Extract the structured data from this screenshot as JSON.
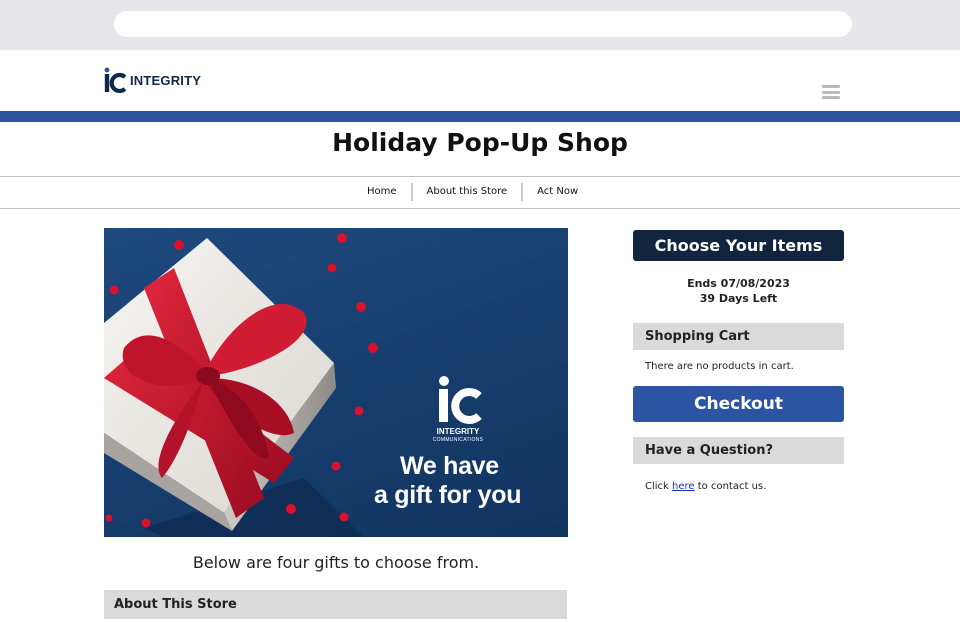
{
  "browser": {
    "url_value": ""
  },
  "header": {
    "logo_text": "INTEGRITY",
    "menu_icon": "hamburger-menu-icon"
  },
  "page": {
    "title": "Holiday Pop-Up Shop"
  },
  "nav": {
    "items": [
      {
        "label": "Home"
      },
      {
        "label": "About this Store"
      },
      {
        "label": "Act Now"
      }
    ]
  },
  "hero": {
    "brand_name": "INTEGRITY",
    "brand_sub": "COMMUNICATIONS",
    "headline_1": "We have",
    "headline_2": "a gift for you"
  },
  "main": {
    "intro": "Below are four gifts to choose from.",
    "about_header": "About This Store"
  },
  "sidebar": {
    "choose_label": "Choose Your Items",
    "ends": "Ends 07/08/2023",
    "days_left": "39 Days Left",
    "cart_header": "Shopping Cart",
    "cart_empty": "There are no products in cart.",
    "checkout_label": "Checkout",
    "question_header": "Have a Question?",
    "contact_prefix": "Click",
    "contact_link": "here",
    "contact_suffix": "to contact us."
  },
  "colors": {
    "brand_blue": "#2c54a3",
    "dark_navy": "#12253f",
    "hero_blue": "#163d6d",
    "ribbon_red": "#c0142c",
    "section_gray": "#dadada"
  }
}
